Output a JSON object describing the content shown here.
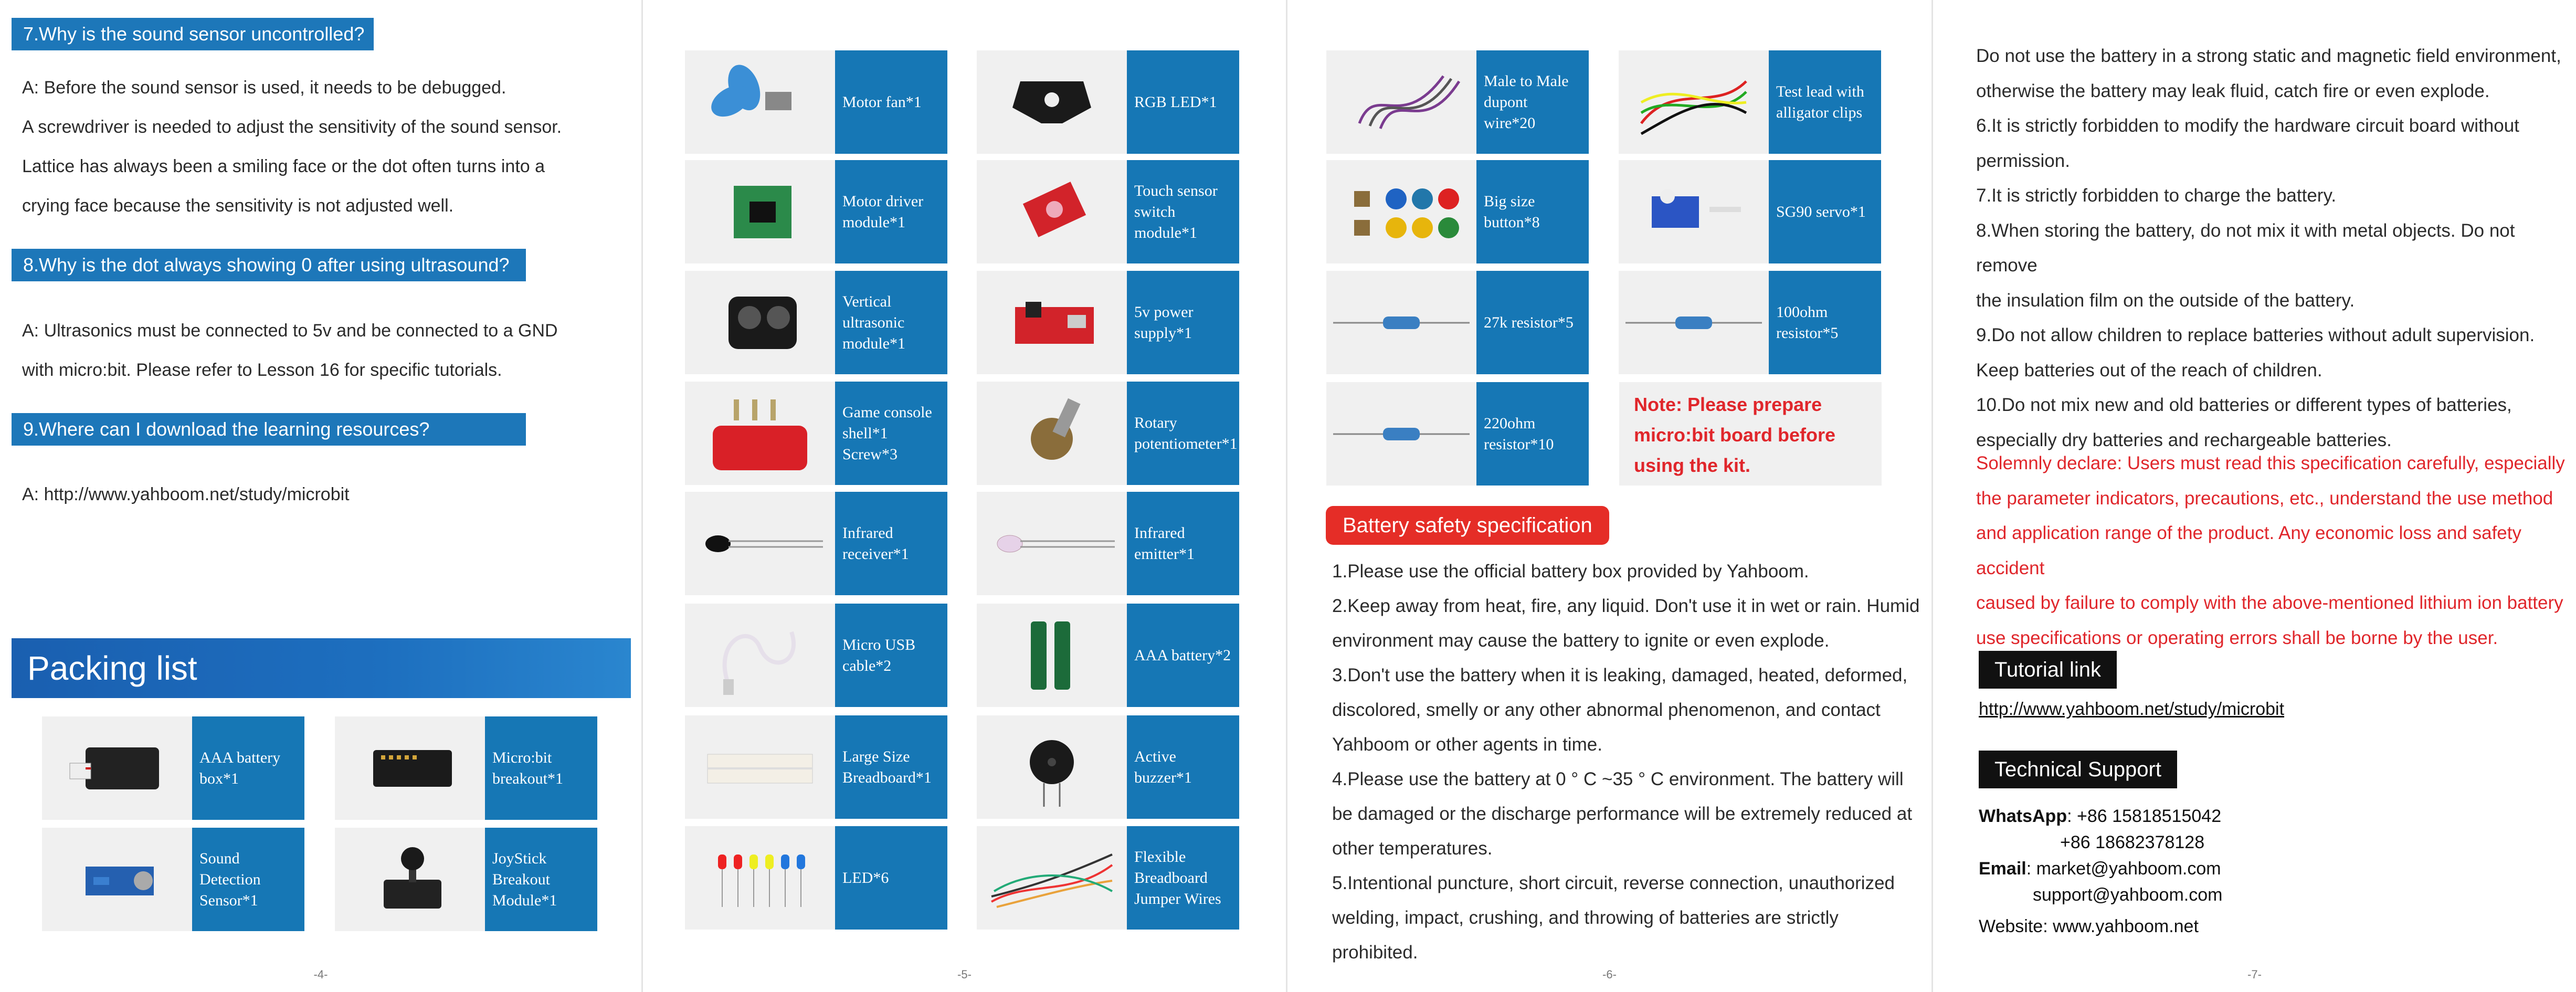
{
  "page4": {
    "questions": [
      {
        "title": "7.Why is the sound sensor uncontrolled?",
        "lines": [
          "A: Before the sound sensor is used, it needs to be debugged.",
          "A screwdriver is needed to adjust the sensitivity of the sound sensor.",
          "Lattice has always been a smiling face or the dot often turns into a",
          "crying face because the sensitivity is not adjusted well."
        ]
      },
      {
        "title": "8.Why is the dot always showing 0 after using ultrasound?",
        "lines": [
          "A: Ultrasonics must be connected to 5v and be connected to a GND",
          "with micro:bit. Please refer to Lesson 16 for specific tutorials."
        ]
      },
      {
        "title": "9.Where can I download the learning resources?",
        "lines": [
          "A: http://www.yahboom.net/study/microbit"
        ]
      }
    ],
    "packing_title": "Packing list",
    "items": [
      {
        "label": "AAA battery box*1",
        "icon": "battery-box-icon"
      },
      {
        "label": "Micro:bit breakout*1",
        "icon": "breakout-board-icon"
      },
      {
        "label": "Sound Detection Sensor*1",
        "icon": "sound-sensor-icon"
      },
      {
        "label": "JoyStick Breakout Module*1",
        "icon": "joystick-icon"
      }
    ],
    "page_number": "-4-"
  },
  "page5": {
    "items": [
      {
        "label": "Motor fan*1",
        "icon": "fan-icon"
      },
      {
        "label": "RGB LED*1",
        "icon": "rgb-led-icon"
      },
      {
        "label": "Motor driver module*1",
        "icon": "motor-driver-icon"
      },
      {
        "label": "Touch sensor switch module*1",
        "icon": "touch-sensor-icon"
      },
      {
        "label": "Vertical ultrasonic module*1",
        "icon": "ultrasonic-icon"
      },
      {
        "label": "5v power supply*1",
        "icon": "power-supply-icon"
      },
      {
        "label": "Game console shell*1 Screw*3",
        "icon": "console-shell-icon"
      },
      {
        "label": "Rotary potentiometer*1",
        "icon": "potentiometer-icon"
      },
      {
        "label": "Infrared receiver*1",
        "icon": "ir-receiver-icon"
      },
      {
        "label": "Infrared emitter*1",
        "icon": "ir-emitter-icon"
      },
      {
        "label": "Micro USB cable*2",
        "icon": "usb-cable-icon"
      },
      {
        "label": "AAA battery*2",
        "icon": "aaa-battery-icon"
      },
      {
        "label": "Large Size Breadboard*1",
        "icon": "breadboard-icon"
      },
      {
        "label": "Active buzzer*1",
        "icon": "buzzer-icon"
      },
      {
        "label": "LED*6",
        "icon": "led-icon"
      },
      {
        "label": "Flexible Breadboard Jumper Wires",
        "icon": "jumper-wires-icon"
      }
    ],
    "page_number": "-5-"
  },
  "page6": {
    "items": [
      {
        "label": "Male to Male dupont wire*20",
        "icon": "dupont-wire-icon"
      },
      {
        "label": "Test lead with alligator clips",
        "icon": "alligator-clip-icon"
      },
      {
        "label": "Big size button*8",
        "icon": "button-caps-icon"
      },
      {
        "label": "SG90 servo*1",
        "icon": "servo-icon"
      },
      {
        "label": "27k resistor*5",
        "icon": "resistor-icon"
      },
      {
        "label": "100ohm resistor*5",
        "icon": "resistor-icon"
      },
      {
        "label": "220ohm resistor*10",
        "icon": "resistor-icon"
      }
    ],
    "note": "Note: Please prepare micro:bit board before using the kit.",
    "safety_title": "Battery safety specification",
    "safety_lines": [
      "1.Please use the official battery box provided by Yahboom.",
      "2.Keep away from heat, fire, any liquid. Don't use it in wet or rain. Humid",
      "environment may cause the battery to ignite or even explode.",
      "3.Don't use the battery when it is leaking, damaged, heated, deformed,",
      "discolored, smelly or any other abnormal phenomenon, and contact",
      "Yahboom or other agents in time.",
      "4.Please use the battery at 0 ° C ~35 ° C environment. The battery will",
      "be damaged or the discharge performance will be extremely reduced at",
      "other temperatures.",
      "5.Intentional puncture, short circuit, reverse connection, unauthorized",
      "welding, impact, crushing, and throwing of batteries are strictly prohibited."
    ],
    "page_number": "-6-"
  },
  "page7": {
    "lines": [
      "Do not use the battery in a strong static and magnetic field environment,",
      "otherwise the battery may leak fluid, catch fire or even explode.",
      "6.It is strictly forbidden to modify the hardware circuit board without",
      "permission.",
      "7.It is strictly forbidden to charge the battery.",
      "8.When storing the battery, do not mix it with metal objects. Do not remove",
      "the insulation film on the outside of the battery.",
      "9.Do not allow children to replace batteries without adult supervision.",
      "Keep batteries out of the reach of children.",
      "10.Do not mix new and old batteries or different types of batteries,",
      "especially dry batteries and rechargeable batteries."
    ],
    "declare_lines": [
      "Solemnly declare: Users must read this specification carefully, especially",
      "the parameter indicators, precautions, etc., understand the use method",
      "and application range of the product.  Any economic loss and safety accident",
      "caused by failure to comply with the above-mentioned lithium ion battery",
      "use specifications or operating errors shall be borne by the user."
    ],
    "tutorial_title": "Tutorial link",
    "tutorial_url": "http://www.yahboom.net/study/microbit",
    "support_title": "Technical Support",
    "whatsapp_label": "WhatsApp",
    "whatsapp_1": ": +86 15818515042",
    "whatsapp_2": "+86 18682378128",
    "email_label": "Email",
    "email_1": ": market@yahboom.com",
    "email_2": "support@yahboom.com",
    "website": "Website: www.yahboom.net",
    "page_number": "-7-"
  }
}
